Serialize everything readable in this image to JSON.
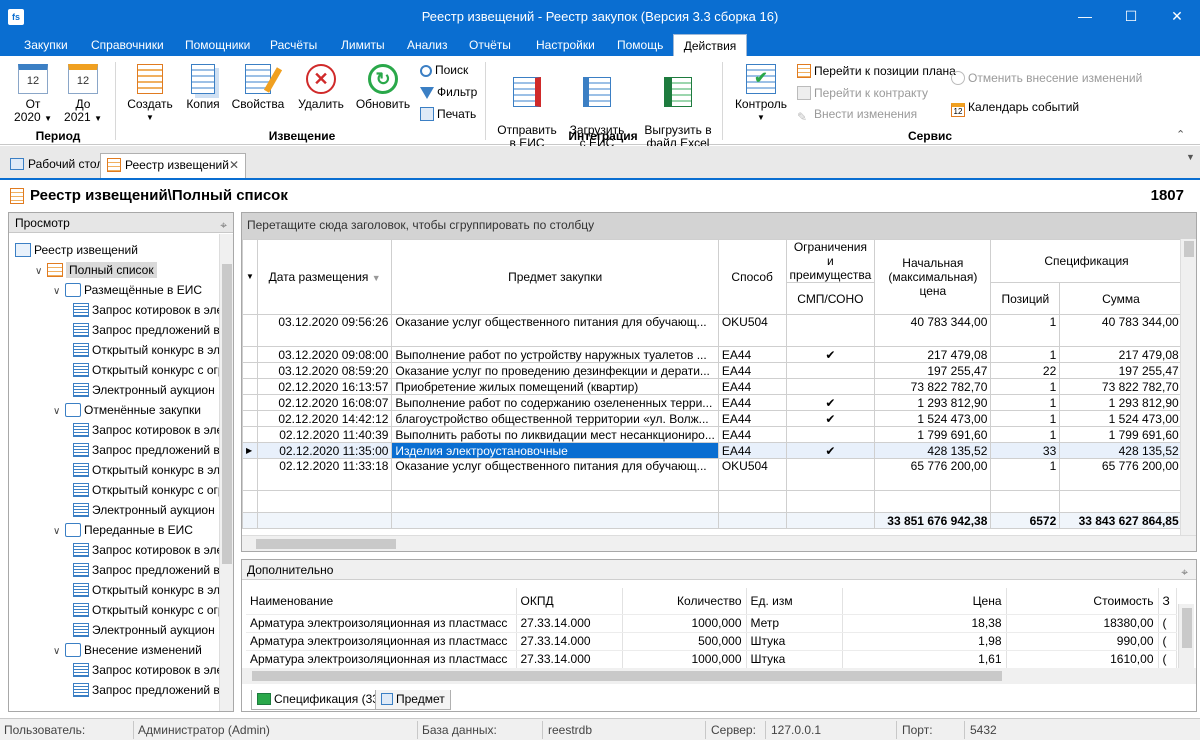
{
  "window": {
    "title": "Реестр извещений - Реестр закупок (Версия 3.3 сборка 16)",
    "app_icon": "fs"
  },
  "menu": [
    "Закупки",
    "Справочники",
    "Помощники",
    "Расчёты",
    "Лимиты",
    "Анализ",
    "Отчёты",
    "Настройки",
    "Помощь",
    "Действия"
  ],
  "ribbon": {
    "period": {
      "from_label": "От",
      "from_year": "2020",
      "from_day": "12",
      "to_label": "До",
      "to_year": "2021",
      "to_day": "12",
      "group": "Период"
    },
    "notice": {
      "create": "Создать",
      "copy": "Копия",
      "props": "Свойства",
      "delete": "Удалить",
      "refresh": "Обновить",
      "search": "Поиск",
      "filter": "Фильтр",
      "print": "Печать",
      "group": "Извещение"
    },
    "integration": {
      "send": "Отправить\nв ЕИС",
      "load": "Загрузить\nс ЕИС",
      "export": "Выгрузить в\nфайл Excel",
      "group": "Интеграция"
    },
    "service": {
      "control": "Контроль",
      "goto_plan": "Перейти к позиции плана",
      "goto_contract": "Перейти к контракту",
      "make_changes": "Внести изменения",
      "cancel_changes": "Отменить внесение изменений",
      "calendar": "Календарь событий",
      "calendar_day": "12",
      "group": "Сервис"
    }
  },
  "doctabs": [
    "Рабочий стол",
    "Реестр извещений"
  ],
  "page": {
    "title": "Реестр извещений\\Полный список",
    "count": "1807"
  },
  "tree": {
    "header": "Просмотр",
    "items": [
      {
        "label": "Реестр извещений",
        "level": 0
      },
      {
        "label": "Полный список",
        "level": 1
      },
      {
        "label": "Размещённые в ЕИС",
        "level": 2
      },
      {
        "label": "Запрос котировок в электр",
        "level": 3
      },
      {
        "label": "Запрос предложений в эле",
        "level": 3
      },
      {
        "label": "Открытый конкурс в элект",
        "level": 3
      },
      {
        "label": "Открытый конкурс с огран",
        "level": 3
      },
      {
        "label": "Электронный аукцион",
        "level": 3
      },
      {
        "label": "Отменённые закупки",
        "level": 2
      },
      {
        "label": "Запрос котировок в электр",
        "level": 3
      },
      {
        "label": "Запрос предложений в эле",
        "level": 3
      },
      {
        "label": "Открытый конкурс в элект",
        "level": 3
      },
      {
        "label": "Открытый конкурс с огран",
        "level": 3
      },
      {
        "label": "Электронный аукцион",
        "level": 3
      },
      {
        "label": "Переданные в ЕИС",
        "level": 2
      },
      {
        "label": "Запрос котировок в электр",
        "level": 3
      },
      {
        "label": "Запрос предложений в эле",
        "level": 3
      },
      {
        "label": "Открытый конкурс в элект",
        "level": 3
      },
      {
        "label": "Открытый конкурс с огран",
        "level": 3
      },
      {
        "label": "Электронный аукцион",
        "level": 3
      },
      {
        "label": "Внесение изменений",
        "level": 2
      },
      {
        "label": "Запрос котировок в электр",
        "level": 3
      },
      {
        "label": "Запрос предложений в эле",
        "level": 3
      }
    ]
  },
  "grid": {
    "group_hint": "Перетащите сюда заголовок, чтобы сгруппировать по столбцу",
    "headers": {
      "date": "Дата размещения",
      "subject": "Предмет закупки",
      "method": "Способ",
      "limits": "Ограничения и преимущества",
      "smp": "СМП/СОНО",
      "price": "Начальная (максимальная) цена",
      "spec": "Спецификация",
      "positions": "Позиций",
      "sum": "Сумма"
    },
    "rows": [
      {
        "date": "03.12.2020 09:56:26",
        "subject": "Оказание услуг общественного питания для обучающ...",
        "method": "OKU504",
        "smp": "",
        "price": "40 783 344,00",
        "positions": "1",
        "sum": "40 783 344,00",
        "tall": true
      },
      {
        "date": "03.12.2020 09:08:00",
        "subject": "Выполнение  работ по устройству наружных туалетов ...",
        "method": "EA44",
        "smp": "✔",
        "price": "217 479,08",
        "positions": "1",
        "sum": "217 479,08"
      },
      {
        "date": "03.12.2020 08:59:20",
        "subject": "Оказание услуг по проведению дезинфекции и дерати...",
        "method": "EA44",
        "smp": "",
        "price": "197 255,47",
        "positions": "22",
        "sum": "197 255,47"
      },
      {
        "date": "02.12.2020 16:13:57",
        "subject": "Приобретение жилых помещений (квартир)",
        "method": "EA44",
        "smp": "",
        "price": "73 822 782,70",
        "positions": "1",
        "sum": "73 822 782,70"
      },
      {
        "date": "02.12.2020 16:08:07",
        "subject": "Выполнение работ по содержанию озелененных терри...",
        "method": "EA44",
        "smp": "✔",
        "price": "1 293 812,90",
        "positions": "1",
        "sum": "1 293 812,90"
      },
      {
        "date": "02.12.2020 14:42:12",
        "subject": "благоустройство общественной территории «ул. Волж...",
        "method": "EA44",
        "smp": "✔",
        "price": "1 524 473,00",
        "positions": "1",
        "sum": "1 524 473,00"
      },
      {
        "date": "02.12.2020 11:40:39",
        "subject": "Выполнить работы по ликвидации мест несанкциониро...",
        "method": "EA44",
        "smp": "",
        "price": "1 799 691,60",
        "positions": "1",
        "sum": "1 799 691,60"
      },
      {
        "date": "02.12.2020 11:35:00",
        "subject": "Изделия электроустановочные",
        "method": "EA44",
        "smp": "✔",
        "price": "428 135,52",
        "positions": "33",
        "sum": "428 135,52",
        "selected": true
      },
      {
        "date": "02.12.2020 11:33:18",
        "subject": "Оказание услуг общественного питания для обучающ...",
        "method": "OKU504",
        "smp": "",
        "price": "65 776 200,00",
        "positions": "1",
        "sum": "65 776 200,00",
        "tall": true
      }
    ],
    "totals": {
      "price": "33 851 676 942,38",
      "positions": "6572",
      "sum": "33 843 627 864,85"
    }
  },
  "detail": {
    "title": "Дополнительно",
    "headers": {
      "name": "Наименование",
      "okpd": "ОКПД",
      "qty": "Количество",
      "unit": "Ед. изм",
      "price": "Цена",
      "cost": "Стоимость",
      "extra": "З"
    },
    "rows": [
      {
        "name": "Арматура электроизоляционная из пластмасс",
        "okpd": "27.33.14.000",
        "qty": "1000,000",
        "unit": "Метр",
        "price": "18,38",
        "cost": "18380,00",
        "extra": "("
      },
      {
        "name": "Арматура электроизоляционная из пластмасс",
        "okpd": "27.33.14.000",
        "qty": "500,000",
        "unit": "Штука",
        "price": "1,98",
        "cost": "990,00",
        "extra": "("
      },
      {
        "name": "Арматура электроизоляционная из пластмасс",
        "okpd": "27.33.14.000",
        "qty": "1000,000",
        "unit": "Штука",
        "price": "1,61",
        "cost": "1610,00",
        "extra": "("
      }
    ]
  },
  "bottom_tabs": [
    "Спецификация (33)",
    "Предмет"
  ],
  "status": {
    "user_label": "Пользователь:",
    "user": "Администратор (Admin)",
    "db_label": "База данных:",
    "db": "reestrdb",
    "server_label": "Сервер:",
    "server": "127.0.0.1",
    "port_label": "Порт:",
    "port": "5432"
  }
}
